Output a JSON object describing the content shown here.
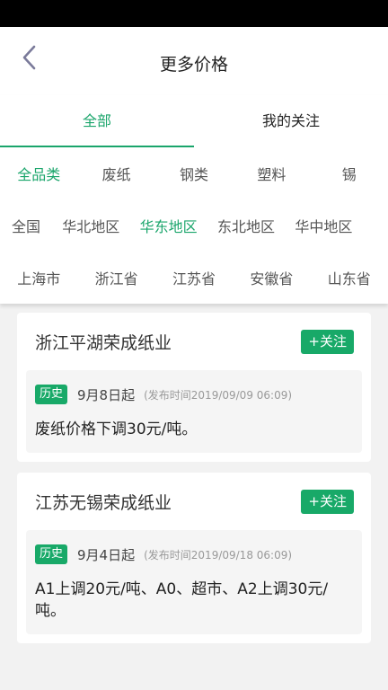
{
  "header": {
    "title": "更多价格"
  },
  "main_tabs": [
    {
      "label": "全部",
      "active": true
    },
    {
      "label": "我的关注",
      "active": false
    }
  ],
  "categories": [
    {
      "label": "全品类",
      "active": true
    },
    {
      "label": "废纸",
      "active": false
    },
    {
      "label": "钢类",
      "active": false
    },
    {
      "label": "塑料",
      "active": false
    },
    {
      "label": "锡",
      "active": false
    }
  ],
  "regions": [
    {
      "label": "全国",
      "active": false
    },
    {
      "label": "华北地区",
      "active": false
    },
    {
      "label": "华东地区",
      "active": true
    },
    {
      "label": "东北地区",
      "active": false
    },
    {
      "label": "华中地区",
      "active": false
    }
  ],
  "provinces": [
    {
      "label": "上海市",
      "active": false
    },
    {
      "label": "浙江省",
      "active": false
    },
    {
      "label": "江苏省",
      "active": false
    },
    {
      "label": "安徽省",
      "active": false
    },
    {
      "label": "山东省",
      "active": false
    }
  ],
  "cards": [
    {
      "company": "浙江平湖荣成纸业",
      "follow_label": "+关注",
      "tag": "历史",
      "date": "9月8日起",
      "published": "(发布时间2019/09/09 06:09)",
      "text": "废纸价格下调30元/吨。"
    },
    {
      "company": "江苏无锡荣成纸业",
      "follow_label": "+关注",
      "tag": "历史",
      "date": "9月4日起",
      "published": "(发布时间2019/09/18 06:09)",
      "text": "A1上调20元/吨、A0、超市、A2上调30元/吨。"
    }
  ],
  "colors": {
    "accent": "#1aa56b"
  }
}
